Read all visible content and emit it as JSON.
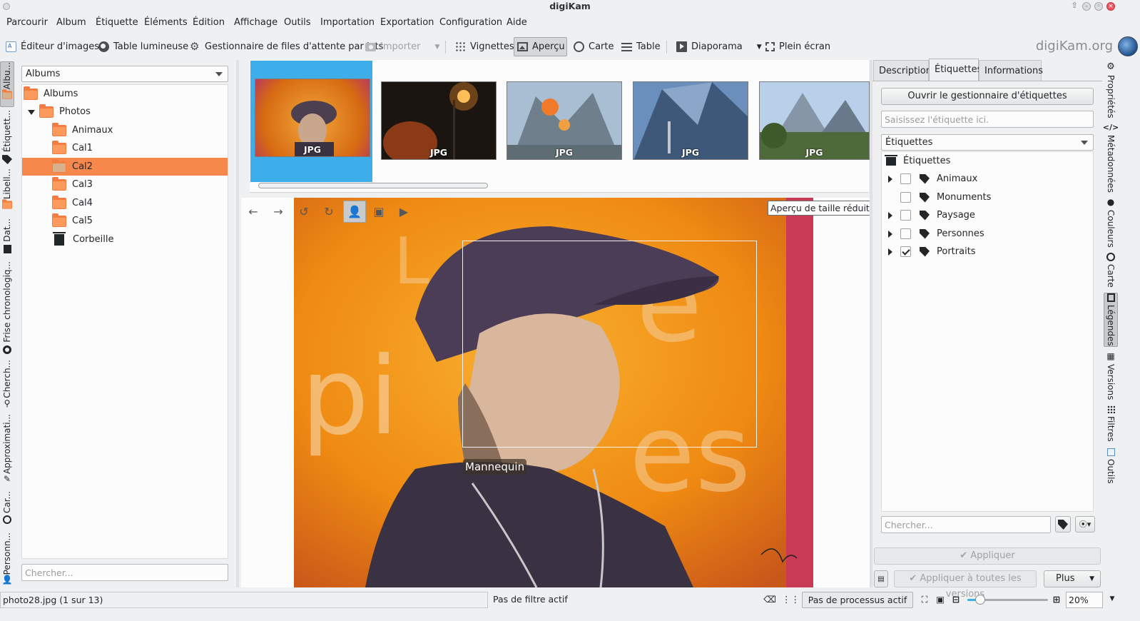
{
  "window": {
    "title": "digiKam"
  },
  "menu": [
    "Parcourir",
    "Album",
    "Étiquette",
    "Éléments",
    "Édition",
    "Affichage",
    "Outils",
    "Importation",
    "Exportation",
    "Configuration",
    "Aide"
  ],
  "toolbar": {
    "image_editor": "Éditeur d'images",
    "light_table": "Table lumineuse",
    "batch_queue": "Gestionnaire de files d'attente par lots",
    "import": "Importer",
    "thumbnails": "Vignettes",
    "preview": "Aperçu",
    "map": "Carte",
    "table": "Table",
    "slideshow": "Diaporama",
    "fullscreen": "Plein écran",
    "brand": "digiKam.org"
  },
  "left_tabs": [
    "Albu...",
    "Étiquett...",
    "Libell...",
    "Dat...",
    "Frise chronologiq...",
    "Cherch...",
    "Approximati...",
    "Car...",
    "Personn..."
  ],
  "albums": {
    "combo": "Albums",
    "items": [
      {
        "label": "Albums",
        "level": 0
      },
      {
        "label": "Photos",
        "level": 1
      },
      {
        "label": "Animaux",
        "level": 2
      },
      {
        "label": "Cal1",
        "level": 2
      },
      {
        "label": "Cal2",
        "level": 2,
        "selected": true
      },
      {
        "label": "Cal3",
        "level": 2
      },
      {
        "label": "Cal4",
        "level": 2
      },
      {
        "label": "Cal5",
        "level": 2
      },
      {
        "label": "Corbeille",
        "level": 2
      }
    ],
    "search_placeholder": "Chercher..."
  },
  "thumbnails": [
    {
      "label": "JPG",
      "selected": true
    },
    {
      "label": "JPG"
    },
    {
      "label": "JPG"
    },
    {
      "label": "JPG"
    },
    {
      "label": "JPG"
    }
  ],
  "preview": {
    "tooltip": "Aperçu de taille réduite",
    "face_label": "Mannequin"
  },
  "right_tabs": {
    "description": "Description",
    "tags": "Étiquettes",
    "info": "Informations"
  },
  "tags_panel": {
    "open_manager": "Ouvrir le gestionnaire d'étiquettes",
    "input_placeholder": "Saisissez l'étiquette ici.",
    "combo": "Étiquettes",
    "root": "Étiquettes",
    "items": [
      {
        "label": "Animaux",
        "checked": false,
        "expandable": true
      },
      {
        "label": "Monuments",
        "checked": false,
        "expandable": false
      },
      {
        "label": "Paysage",
        "checked": false,
        "expandable": true
      },
      {
        "label": "Personnes",
        "checked": false,
        "expandable": true
      },
      {
        "label": "Portraits",
        "checked": true,
        "expandable": true
      }
    ],
    "search_placeholder": "Chercher...",
    "apply": "Appliquer",
    "apply_all": "Appliquer à toutes les versions",
    "more": "Plus"
  },
  "right_side_tabs": [
    "Propriétés",
    "Métadonnées",
    "Couleurs",
    "Carte",
    "Légendes",
    "Versions",
    "Filtres",
    "Outils"
  ],
  "status": {
    "file": "photo28.jpg (1 sur 13)",
    "filter": "Pas de filtre actif",
    "process": "Pas de processus actif",
    "zoom": "20%",
    "zoom_fraction": 0.2
  }
}
